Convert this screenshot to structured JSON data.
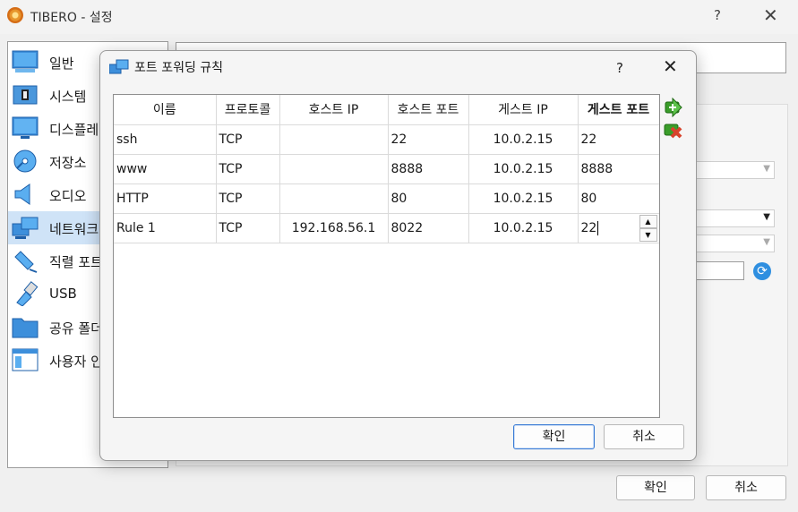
{
  "back_window": {
    "title": "TIBERO - 설정",
    "help_glyph": "?",
    "close_glyph": "✕",
    "sidebar": [
      {
        "label": "일반",
        "icon": "monitor-icon"
      },
      {
        "label": "시스템",
        "icon": "chip-icon"
      },
      {
        "label": "디스플레",
        "icon": "display-icon"
      },
      {
        "label": "저장소",
        "icon": "disk-icon"
      },
      {
        "label": "오디오",
        "icon": "speaker-icon"
      },
      {
        "label": "네트워크",
        "icon": "network-icon",
        "selected": true
      },
      {
        "label": "직렬 포트",
        "icon": "serial-port-icon"
      },
      {
        "label": "USB",
        "icon": "usb-icon"
      },
      {
        "label": "공유 폴더",
        "icon": "folder-icon"
      },
      {
        "label": "사용자 인",
        "icon": "user-interface-icon"
      }
    ],
    "ok_label": "확인",
    "cancel_label": "취소"
  },
  "dialog": {
    "title": "포트 포워딩 규칙",
    "help_glyph": "?",
    "close_glyph": "✕",
    "columns": [
      "이름",
      "프로토콜",
      "호스트 IP",
      "호스트 포트",
      "게스트 IP",
      "게스트 포트"
    ],
    "rows": [
      {
        "name": "ssh",
        "protocol": "TCP",
        "host_ip": "",
        "host_port": "22",
        "guest_ip": "10.0.2.15",
        "guest_port": "22"
      },
      {
        "name": "www",
        "protocol": "TCP",
        "host_ip": "",
        "host_port": "8888",
        "guest_ip": "10.0.2.15",
        "guest_port": "8888"
      },
      {
        "name": "HTTP",
        "protocol": "TCP",
        "host_ip": "",
        "host_port": "80",
        "guest_ip": "10.0.2.15",
        "guest_port": "80"
      },
      {
        "name": "Rule 1",
        "protocol": "TCP",
        "host_ip": "192.168.56.1",
        "host_port": "8022",
        "guest_ip": "10.0.2.15",
        "guest_port": "22"
      }
    ],
    "ok_label": "확인",
    "cancel_label": "취소",
    "colors": {
      "add_icon": "#3a9d2a",
      "remove_icon": "#d8432c",
      "accent": "#3a7bd5"
    }
  }
}
